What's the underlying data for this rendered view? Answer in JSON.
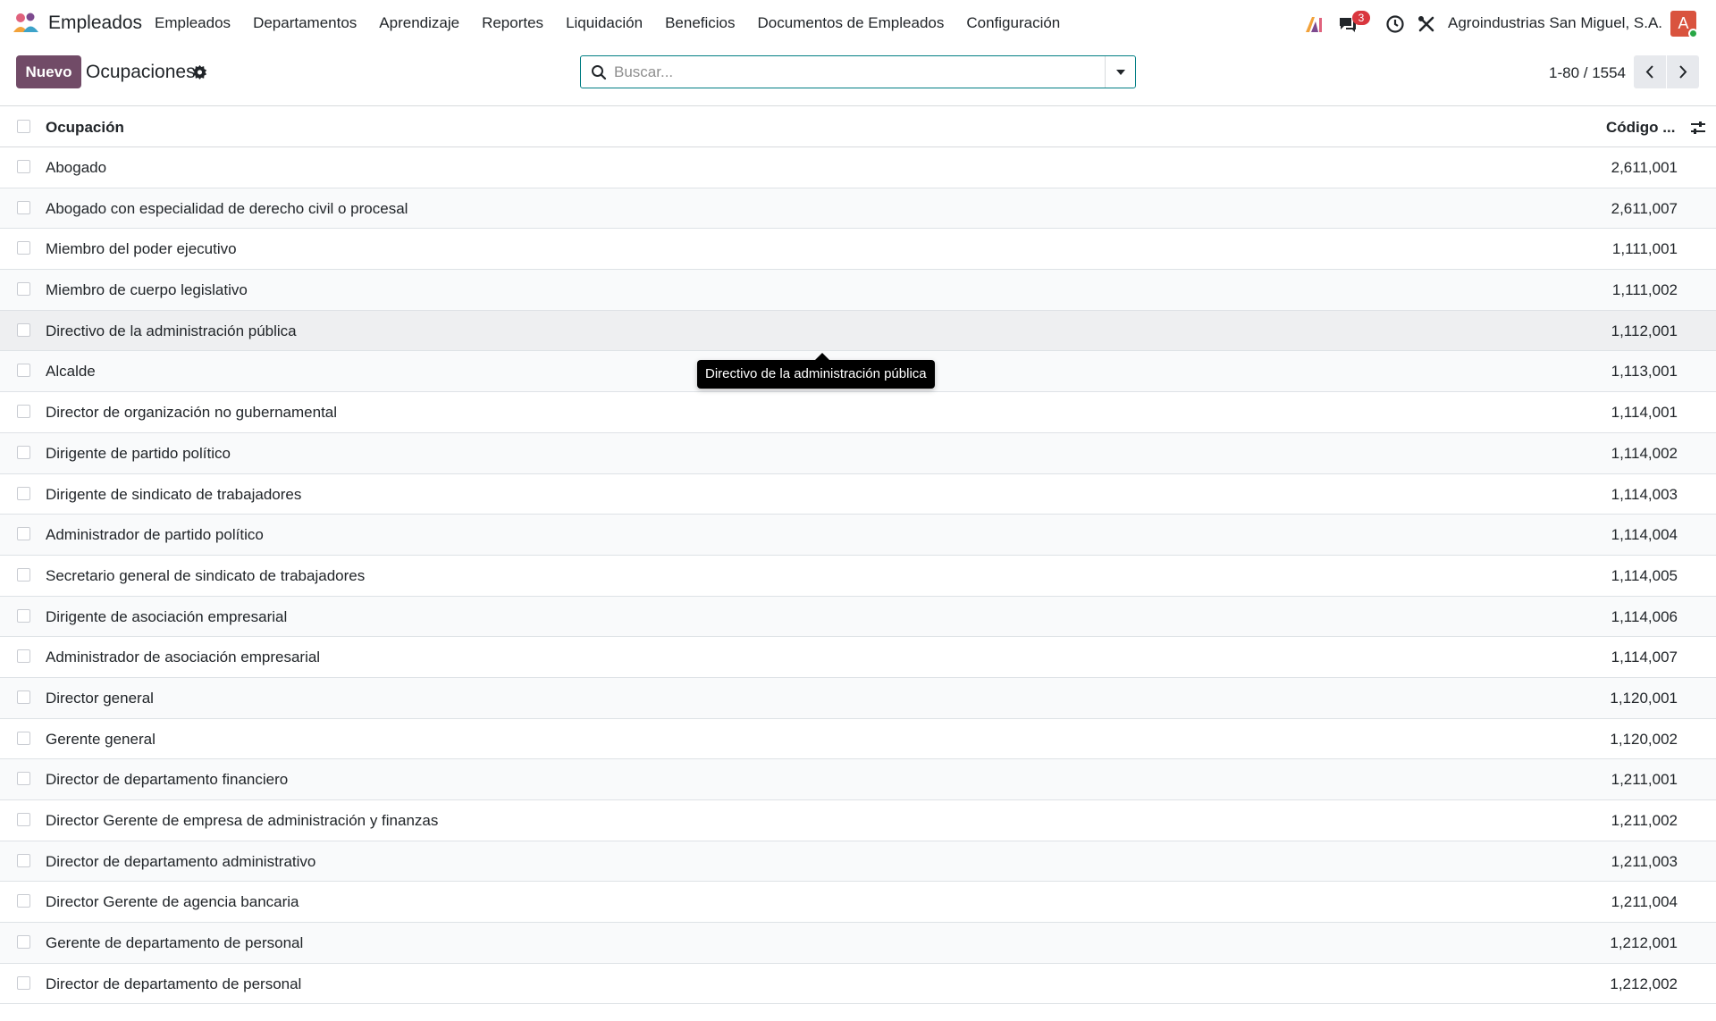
{
  "app": {
    "name": "Empleados"
  },
  "menu": [
    "Empleados",
    "Departamentos",
    "Aprendizaje",
    "Reportes",
    "Liquidación",
    "Beneficios",
    "Documentos de Empleados",
    "Configuración"
  ],
  "systray": {
    "messages_count": "3",
    "company": "Agroindustrias San Miguel, S.A.",
    "avatar_initial": "A"
  },
  "control": {
    "new_label": "Nuevo",
    "title": "Ocupaciones",
    "search_placeholder": "Buscar...",
    "search_value": "",
    "pager": "1-80 / 1554"
  },
  "list": {
    "columns": [
      "Ocupación",
      "Código ..."
    ],
    "rows": [
      {
        "name": "Abogado",
        "code": "2,611,001"
      },
      {
        "name": "Abogado con especialidad de derecho civil o procesal",
        "code": "2,611,007"
      },
      {
        "name": "Miembro del poder ejecutivo",
        "code": "1,111,001"
      },
      {
        "name": "Miembro de cuerpo legislativo",
        "code": "1,111,002"
      },
      {
        "name": "Directivo de la administración pública",
        "code": "1,112,001"
      },
      {
        "name": "Alcalde",
        "code": "1,113,001"
      },
      {
        "name": "Director de organización no gubernamental",
        "code": "1,114,001"
      },
      {
        "name": "Dirigente de partido político",
        "code": "1,114,002"
      },
      {
        "name": "Dirigente de sindicato de trabajadores",
        "code": "1,114,003"
      },
      {
        "name": "Administrador de partido político",
        "code": "1,114,004"
      },
      {
        "name": "Secretario general de sindicato de trabajadores",
        "code": "1,114,005"
      },
      {
        "name": "Dirigente de asociación empresarial",
        "code": "1,114,006"
      },
      {
        "name": "Administrador de asociación empresarial",
        "code": "1,114,007"
      },
      {
        "name": "Director general",
        "code": "1,120,001"
      },
      {
        "name": "Gerente general",
        "code": "1,120,002"
      },
      {
        "name": "Director de departamento financiero",
        "code": "1,211,001"
      },
      {
        "name": "Director Gerente de empresa de administración y finanzas",
        "code": "1,211,002"
      },
      {
        "name": "Director de departamento administrativo",
        "code": "1,211,003"
      },
      {
        "name": "Director Gerente de agencia bancaria",
        "code": "1,211,004"
      },
      {
        "name": "Gerente de departamento de personal",
        "code": "1,212,001"
      },
      {
        "name": "Director de departamento de personal",
        "code": "1,212,002"
      }
    ]
  },
  "tooltip": {
    "text": "Directivo de la administración pública"
  },
  "colors": {
    "primary": "#714b67",
    "search_border": "#017e84",
    "badge": "#d9363e"
  }
}
